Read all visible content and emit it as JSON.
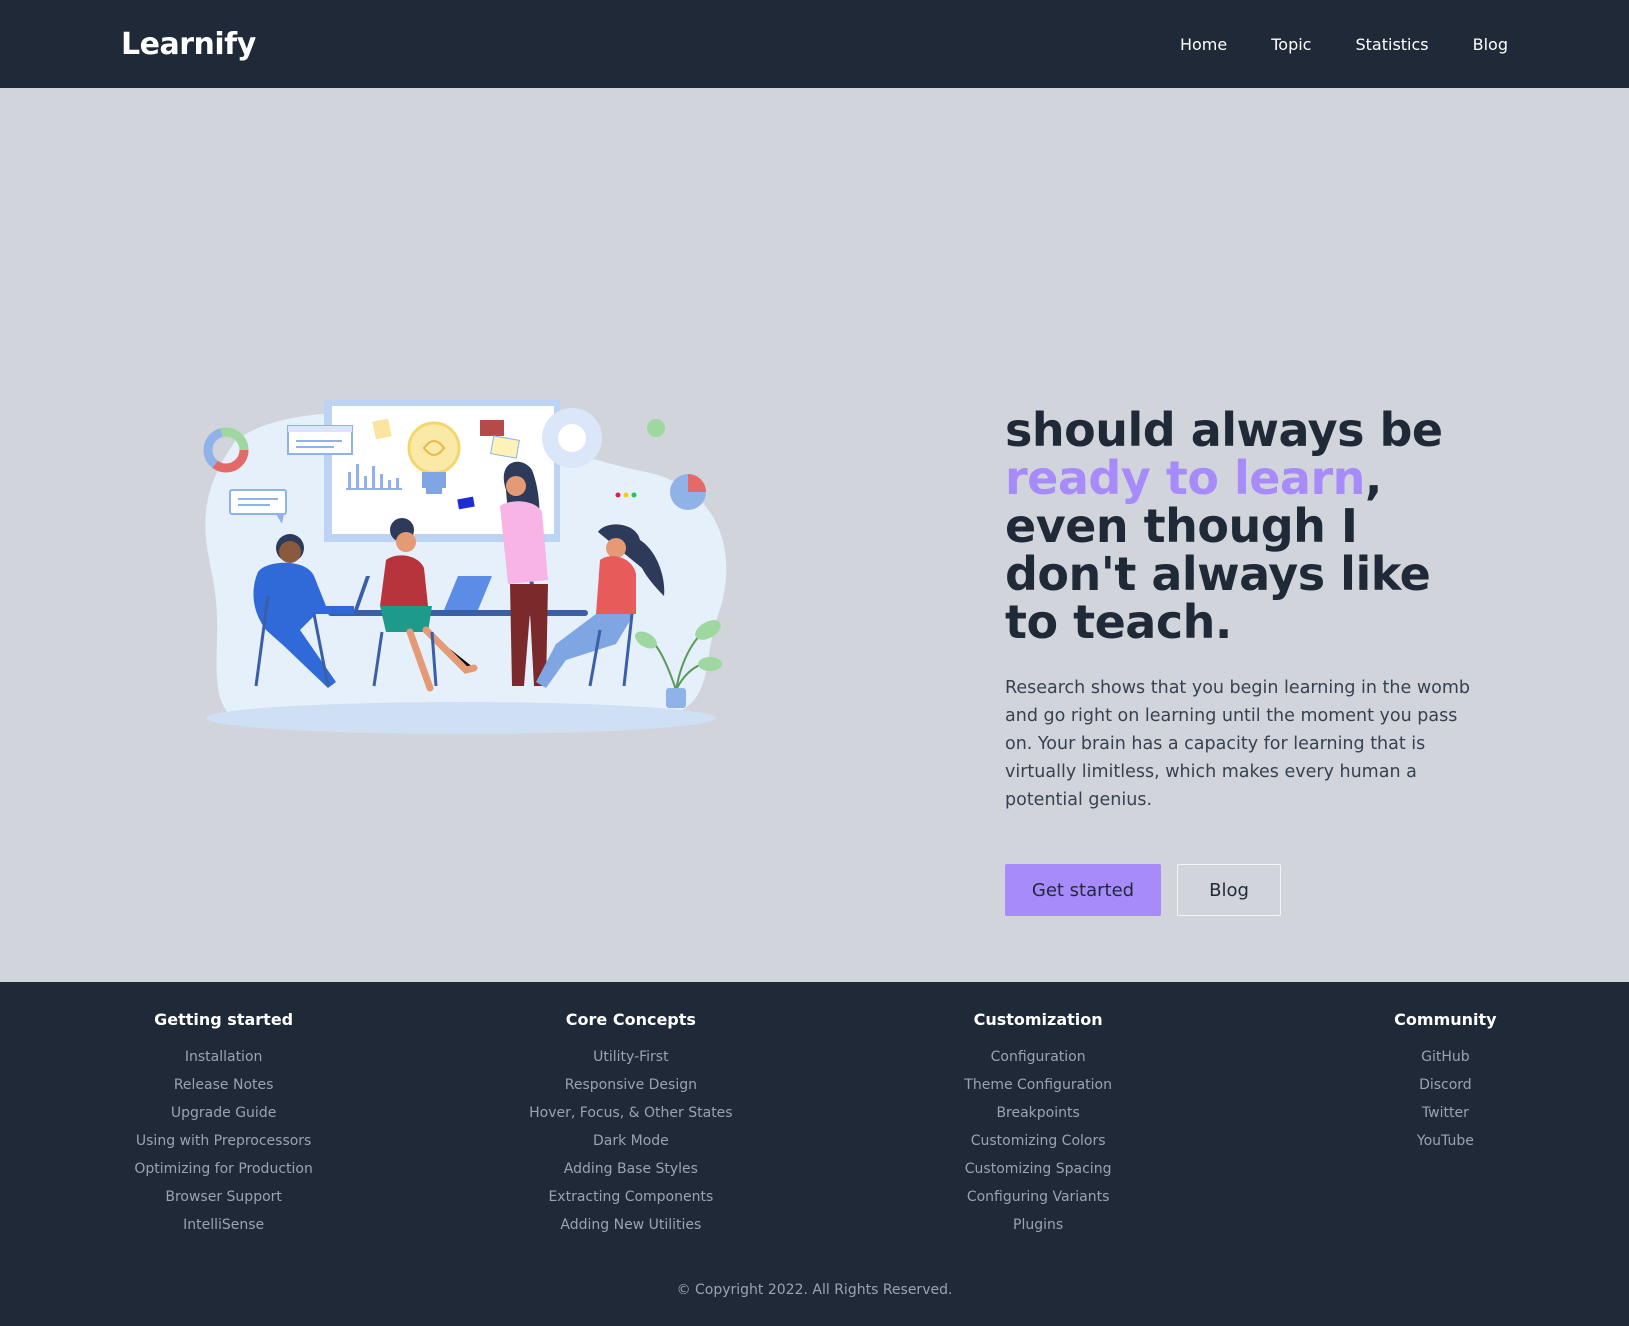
{
  "header": {
    "brand": "Learnify",
    "nav": [
      {
        "label": "Home"
      },
      {
        "label": "Topic"
      },
      {
        "label": "Statistics"
      },
      {
        "label": "Blog"
      }
    ]
  },
  "hero": {
    "headline_before": "should always be ",
    "headline_accent": "ready to learn",
    "headline_after": ", even though I don't always like to teach.",
    "description": "Research shows that you begin learning in the womb and go right on learning until the moment you pass on. Your brain has a capacity for learning that is virtually limitless, which makes every human a potential genius.",
    "primary_button": "Get started",
    "secondary_button": "Blog"
  },
  "footer": {
    "columns": [
      {
        "title": "Getting started",
        "links": [
          "Installation",
          "Release Notes",
          "Upgrade Guide",
          "Using with Preprocessors",
          "Optimizing for Production",
          "Browser Support",
          "IntelliSense"
        ]
      },
      {
        "title": "Core Concepts",
        "links": [
          "Utility-First",
          "Responsive Design",
          "Hover, Focus, & Other States",
          "Dark Mode",
          "Adding Base Styles",
          "Extracting Components",
          "Adding New Utilities"
        ]
      },
      {
        "title": "Customization",
        "links": [
          "Configuration",
          "Theme Configuration",
          "Breakpoints",
          "Customizing Colors",
          "Customizing Spacing",
          "Configuring Variants",
          "Plugins"
        ]
      },
      {
        "title": "Community",
        "links": [
          "GitHub",
          "Discord",
          "Twitter",
          "YouTube"
        ]
      }
    ],
    "copyright": "© Copyright 2022. All Rights Reserved."
  },
  "colors": {
    "header_bg": "#1f2937",
    "hero_bg": "#d1d5db",
    "accent": "#a78bfa",
    "footer_link": "#9ca3af"
  }
}
